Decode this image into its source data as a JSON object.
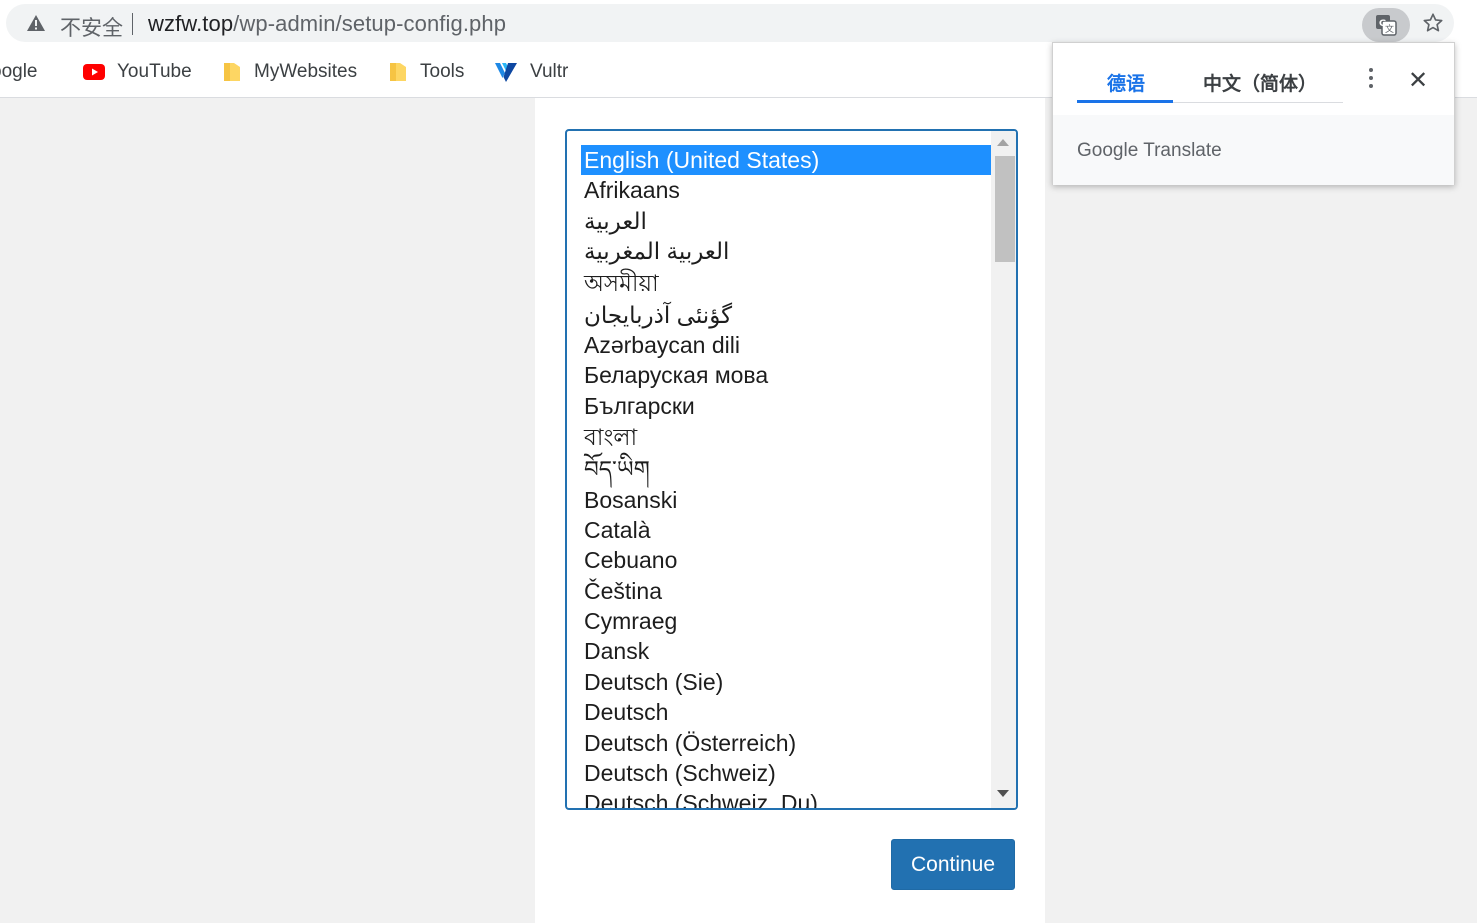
{
  "omnibox": {
    "security_label": "不安全",
    "url_host": "wzfw.top",
    "url_path": "/wp-admin/setup-config.php"
  },
  "bookmarks": [
    {
      "label": "oogle",
      "icon": "google-icon"
    },
    {
      "label": "YouTube",
      "icon": "youtube-icon"
    },
    {
      "label": "MyWebsites",
      "icon": "folder-icon"
    },
    {
      "label": "Tools",
      "icon": "folder-icon"
    },
    {
      "label": "Vultr",
      "icon": "vultr-icon"
    }
  ],
  "language_list": {
    "selected": "English (United States)",
    "options": [
      "English (United States)",
      "Afrikaans",
      "العربية",
      "العربية المغربية",
      "অসমীয়া",
      "گؤنئی آذربایجان",
      "Azərbaycan dili",
      "Беларуская мова",
      "Български",
      "বাংলা",
      "བོད་ཡིག",
      "Bosanski",
      "Català",
      "Cebuano",
      "Čeština",
      "Cymraeg",
      "Dansk",
      "Deutsch (Sie)",
      "Deutsch",
      "Deutsch (Österreich)",
      "Deutsch (Schweiz)",
      "Deutsch (Schweiz, Du)"
    ]
  },
  "continue_label": "Continue",
  "translate_popup": {
    "tab_source": "德语",
    "tab_target": "中文（简体）",
    "footer_brand": "Google Translate"
  },
  "colors": {
    "accent": "#2271b1",
    "selected_option": "#1e90ff",
    "translate_blue": "#1a73e8"
  }
}
